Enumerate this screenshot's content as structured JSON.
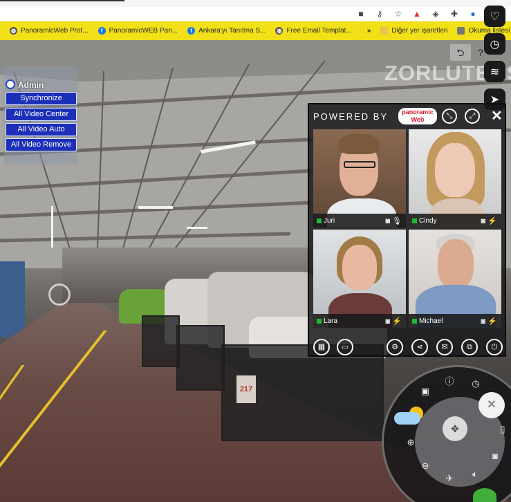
{
  "browser": {
    "bookmarks": [
      {
        "label": "PanoramicWeb Prot...",
        "icon": "panoramicweb-icon"
      },
      {
        "label": "PanoramicWEB Pan...",
        "icon": "facebook-icon"
      },
      {
        "label": "Ankara'yı Tanıtma S...",
        "icon": "facebook-icon"
      },
      {
        "label": "Free Email Templat...",
        "icon": "globe-icon"
      }
    ],
    "overflow": "»",
    "other_bookmarks": "Diğer yer işaretleri",
    "reading_list": "Okuma listesi"
  },
  "scene": {
    "brand": "ZORLUTEKS",
    "cart_tag": "217"
  },
  "admin_menu": {
    "title": "Admin",
    "buttons": [
      "Synchronize",
      "All Video Center",
      "All Video Auto",
      "All Video Remove"
    ]
  },
  "video_panel": {
    "powered_by": "POWERED BY",
    "brand_line1": "panoramic",
    "brand_line2": "Web",
    "participants": [
      {
        "name": "Juri",
        "mic": "on",
        "status_color": "#1fbb3a"
      },
      {
        "name": "Cindy",
        "mic": "muted",
        "status_color": "#1fbb3a"
      },
      {
        "name": "Lara",
        "mic": "muted",
        "status_color": "#1fbb3a"
      },
      {
        "name": "Michael",
        "mic": "muted",
        "status_color": "#1fbb3a"
      }
    ]
  },
  "colors": {
    "bookmark_bar": "#f2e019",
    "admin_button": "#1c2fb8",
    "status_green": "#1fbb3a"
  }
}
